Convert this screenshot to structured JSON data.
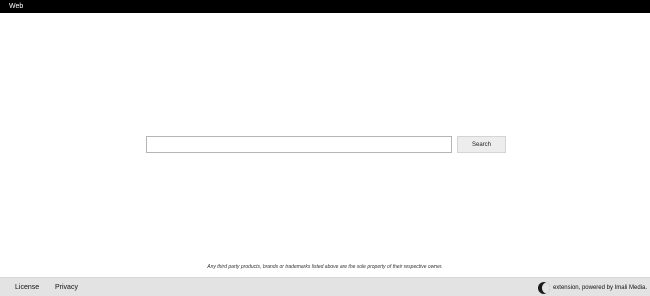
{
  "header": {
    "web_label": "Web"
  },
  "search": {
    "value": "",
    "placeholder": "",
    "button_label": "Search"
  },
  "disclaimer": "Any third party products, brands or trademarks listed above are the sole property of their respective owner.",
  "footer": {
    "license_label": "License",
    "privacy_label": "Privacy",
    "brand_text": "extension, powered by Imali Media."
  },
  "colors": {
    "topbar": "#000000",
    "footer_bg": "#e3e3e3",
    "button_bg": "#ededed"
  }
}
